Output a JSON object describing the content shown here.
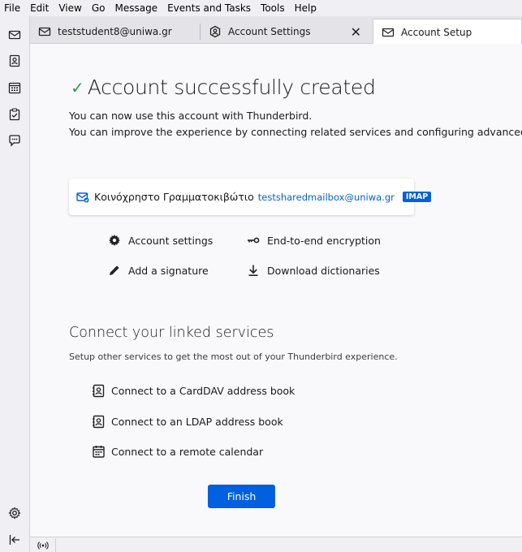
{
  "menubar": {
    "items": [
      "File",
      "Edit",
      "View",
      "Go",
      "Message",
      "Events and Tasks",
      "Tools",
      "Help"
    ]
  },
  "spaces": {
    "mail": "mail-icon",
    "address_book": "address-book-icon",
    "calendar": "calendar-icon",
    "tasks": "tasks-icon",
    "chat": "chat-icon",
    "settings": "gear-icon",
    "collapse": "collapse-sidebar-icon"
  },
  "tabs": [
    {
      "label": "teststudent8@uniwa.gr",
      "icon": "mail-icon",
      "selected": false
    },
    {
      "label": "Account Settings",
      "icon": "account-settings-icon",
      "selected": false
    },
    {
      "label": "Account Setup",
      "icon": "mail-icon",
      "selected": true
    }
  ],
  "setup": {
    "success_title": "Account successfully created",
    "success_desc_1": "You can now use this account with Thunderbird.",
    "success_desc_2": "You can improve the experience by connecting related services and configuring advanced account settings.",
    "account": {
      "name": "Κοινόχρηστο Γραμματοκιβώτιο",
      "email": "testsharedmailbox@uniwa.gr",
      "protocol": "IMAP"
    },
    "actions": {
      "account_settings": "Account settings",
      "encryption": "End-to-end encryption",
      "signature": "Add a signature",
      "dictionaries": "Download dictionaries"
    },
    "linked_title": "Connect your linked services",
    "linked_desc": "Setup other services to get the most out of your Thunderbird experience.",
    "linked": {
      "carddav": "Connect to a CardDAV address book",
      "ldap": "Connect to an LDAP address book",
      "calendar": "Connect to a remote calendar"
    },
    "finish_label": "Finish"
  },
  "colors": {
    "accent": "#0060df",
    "success": "#2e9e3e"
  }
}
